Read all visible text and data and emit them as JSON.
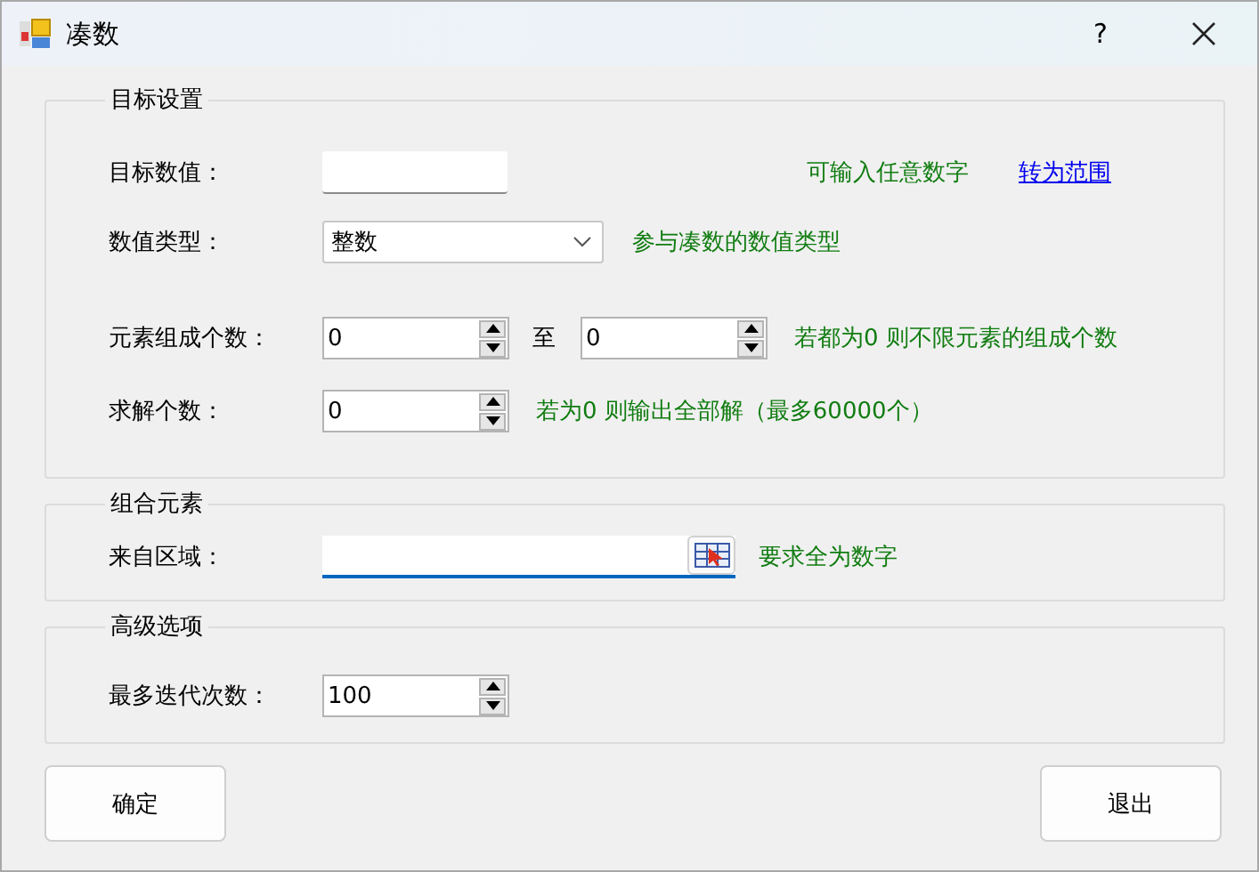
{
  "window": {
    "title": "凑数",
    "help": "?"
  },
  "target_settings": {
    "title": "目标设置",
    "target_value": {
      "label": "目标数值：",
      "hint": "可输入任意数字",
      "link": "转为范围"
    },
    "value_type": {
      "label": "数值类型：",
      "value": "整数",
      "hint": "参与凑数的数值类型"
    },
    "element_count": {
      "label": "元素组成个数：",
      "from": "0",
      "separator": "至",
      "to": "0",
      "hint": "若都为0 则不限元素的组成个数"
    },
    "solution_count": {
      "label": "求解个数：",
      "value": "0",
      "hint": "若为0 则输出全部解（最多60000个）"
    }
  },
  "combination": {
    "title": "组合元素",
    "source_range": {
      "label": "来自区域：",
      "focused": true,
      "hint": "要求全为数字"
    }
  },
  "advanced": {
    "title": "高级选项",
    "max_iterations": {
      "label": "最多迭代次数：",
      "value": "100"
    }
  },
  "buttons": [
    {
      "label": "确定"
    },
    {
      "label": "退出"
    }
  ]
}
